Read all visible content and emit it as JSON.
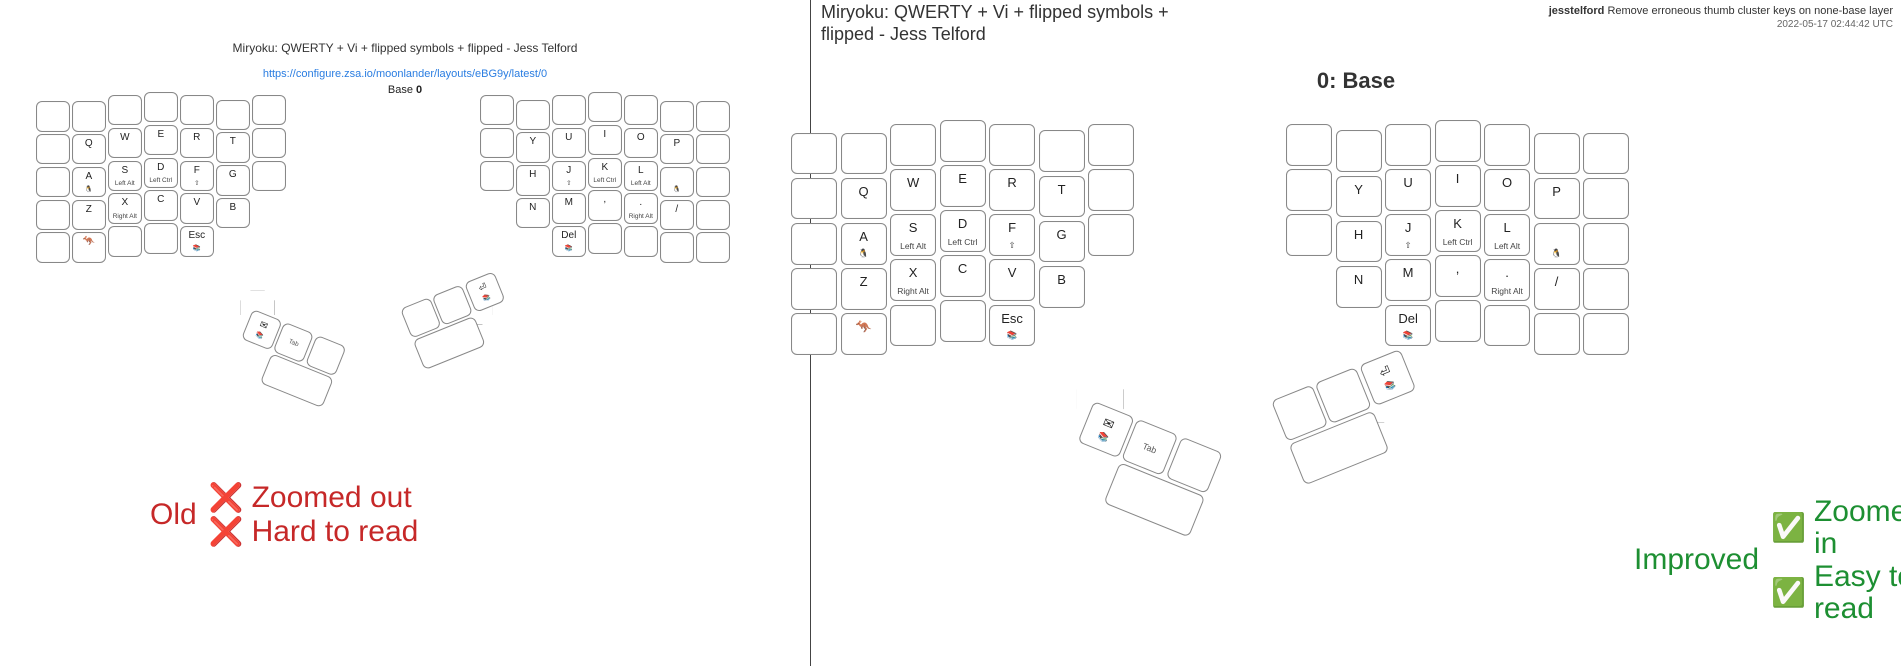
{
  "left_panel": {
    "title": "Miryoku: QWERTY + Vi + flipped symbols + flipped - Jess Telford",
    "url": "https://configure.zsa.io/moonlander/layouts/eBG9y/latest/0",
    "layer_prefix": "Base",
    "layer_num": "0"
  },
  "right_panel": {
    "title": "Miryoku: QWERTY + Vi + flipped symbols + flipped - Jess Telford",
    "author": "jesstelford",
    "commit_msg": "Remove erroneous thumb cluster keys on none-base layer",
    "date": "2022-05-17 02:44:42 UTC",
    "layer": "0: Base"
  },
  "captions": {
    "old_label": "Old",
    "old_line1": "Zoomed out",
    "old_line2": "Hard to read",
    "improved_label": "Improved",
    "improved_line1": "Zoomed in",
    "improved_line2": "Easy to read"
  },
  "keys": {
    "left_half": {
      "row0": [
        "",
        "",
        "",
        "",
        "",
        "",
        ""
      ],
      "row1": [
        "",
        "Q",
        "W",
        "E",
        "R",
        "T",
        ""
      ],
      "row2": [
        "",
        "A",
        "S",
        "D",
        "F",
        "G",
        ""
      ],
      "row2_sub": [
        "",
        "🐧",
        "Left Alt",
        "Left Ctrl",
        "⇧",
        "",
        ""
      ],
      "row3": [
        "",
        "Z",
        "X",
        "C",
        "V",
        "B"
      ],
      "row3_sub": [
        "",
        "",
        "Right Alt",
        "",
        "",
        ""
      ],
      "row4": [
        "",
        "🦘",
        "",
        "",
        "Esc"
      ],
      "row4_sub": [
        "",
        "",
        "",
        "",
        "📚"
      ]
    },
    "right_half": {
      "row0": [
        "",
        "",
        "",
        "",
        "",
        "",
        ""
      ],
      "row1": [
        "",
        "Y",
        "U",
        "I",
        "O",
        "P",
        ""
      ],
      "row2": [
        "",
        "H",
        "J",
        "K",
        "L",
        "",
        ""
      ],
      "row2_sub": [
        "",
        "",
        "⇧",
        "Left Ctrl",
        "Left Alt",
        "🐧",
        ""
      ],
      "row3": [
        "N",
        "M",
        ",",
        ".",
        "/",
        ""
      ],
      "row3_sub": [
        "",
        "",
        "",
        "Right Alt",
        "",
        ""
      ],
      "row4": [
        "Del",
        "",
        "",
        "",
        ""
      ],
      "row4_sub": [
        "📚",
        "",
        "",
        "",
        ""
      ]
    },
    "thumb_left": {
      "keys": [
        {
          "label": "✉",
          "sub": "📚"
        },
        {
          "label": "",
          "sub": "Tab"
        },
        {
          "label": "",
          "sub": ""
        }
      ]
    },
    "thumb_right": {
      "keys": [
        {
          "label": "⏎",
          "sub": "📚"
        },
        {
          "label": "",
          "sub": ""
        },
        {
          "label": "",
          "sub": ""
        }
      ]
    }
  }
}
